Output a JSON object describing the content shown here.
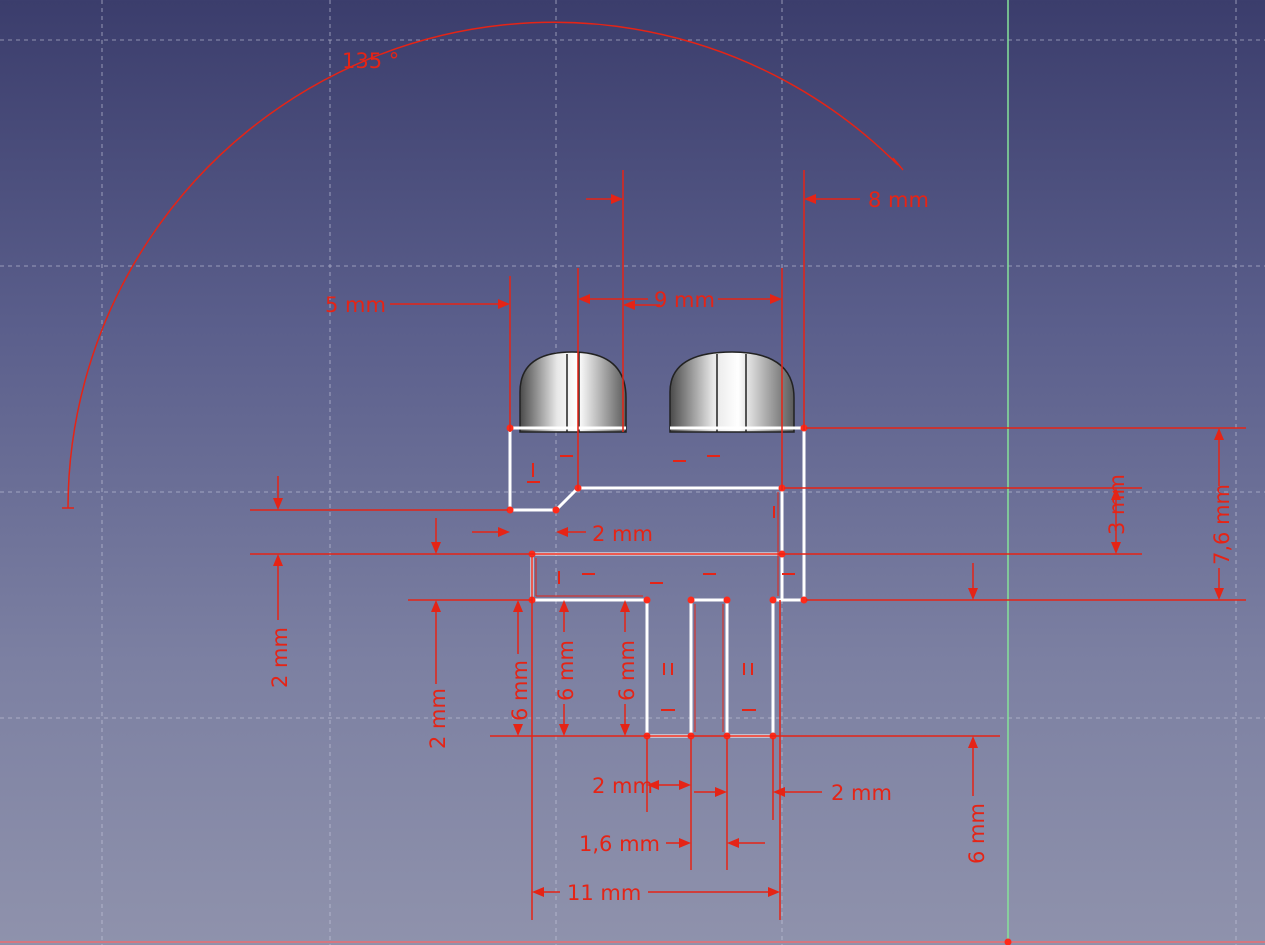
{
  "view": {
    "background_top": "#3b3d6c",
    "background_bottom": "#8f92ac",
    "grid_color": "#c7c9dd",
    "dimension_color": "#e52416",
    "geometry_color": "#ffffff",
    "vertex_color": "#ff2a1a",
    "axis_color": "#86e39a"
  },
  "dimensions": {
    "angle_135": "135 °",
    "d_8mm": "8 mm",
    "d_9mm": "9 mm",
    "d_5mm": "5 mm",
    "d_2mm_a": "2 mm",
    "d_3mm": "3 mm",
    "d_7_6mm": "7,6 mm",
    "d_2mm_left_v": "2 mm",
    "d_2mm_left_v2": "2 mm",
    "d_6mm_a": "6 mm",
    "d_6mm_b": "6 mm",
    "d_6mm_c": "6 mm",
    "d_2mm_b": "2 mm",
    "d_2mm_c": "2 mm",
    "d_1_6mm": "1,6 mm",
    "d_11mm": "11 mm",
    "d_6mm_right_v": "6 mm"
  },
  "constraint_icons": [
    "horizontal-constraint-icon",
    "vertical-constraint-icon",
    "equal-constraint-icon",
    "coincident-constraint-icon"
  ]
}
